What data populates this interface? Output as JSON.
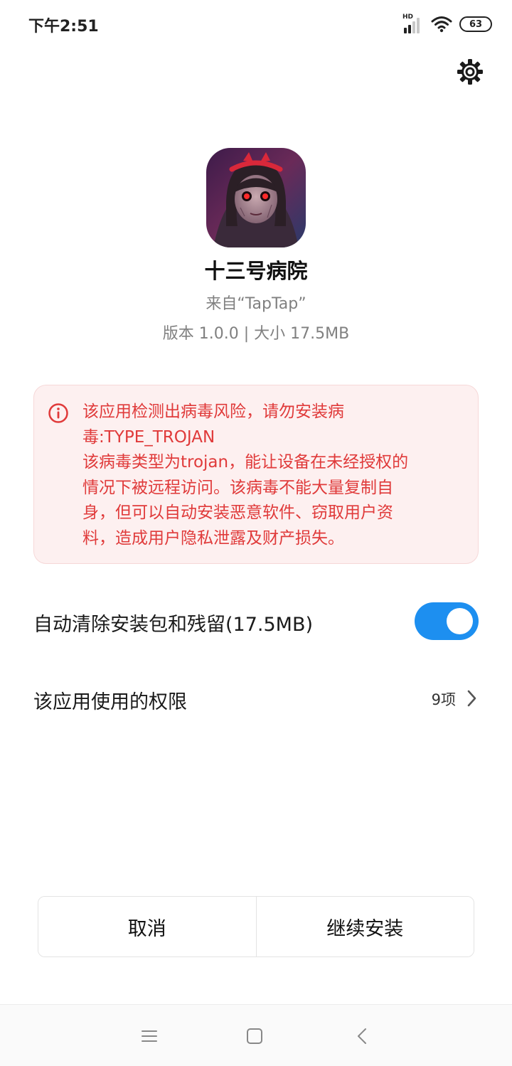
{
  "status_bar": {
    "time": "下午2:51",
    "network_label": "HD",
    "battery": "63"
  },
  "icons": {
    "settings": "gear-icon",
    "warning": "info-circle-icon",
    "chevron": "chevron-right-icon"
  },
  "app": {
    "name": "十三号病院",
    "source": "来自“TapTap”",
    "meta": "版本 1.0.0 | 大小 17.5MB"
  },
  "warning": {
    "lines": [
      "该应用检测出病毒风险，请勿安装病",
      "毒:TYPE_TROJAN",
      "该病毒类型为trojan，能让设备在未经授权的",
      "情况下被远程访问。该病毒不能大量复制自",
      "身，但可以自动安装恶意软件、窃取用户资",
      "料，造成用户隐私泄露及财产损失。"
    ]
  },
  "settings": {
    "auto_clean_label": "自动清除安装包和残留(17.5MB)",
    "auto_clean_on": true,
    "permissions_label": "该应用使用的权限",
    "permissions_count": "9项"
  },
  "actions": {
    "cancel": "取消",
    "continue": "继续安装"
  },
  "colors": {
    "warning_text": "#e03a3a",
    "warning_bg": "#fdf0f0",
    "toggle_on": "#1d8ff0"
  }
}
